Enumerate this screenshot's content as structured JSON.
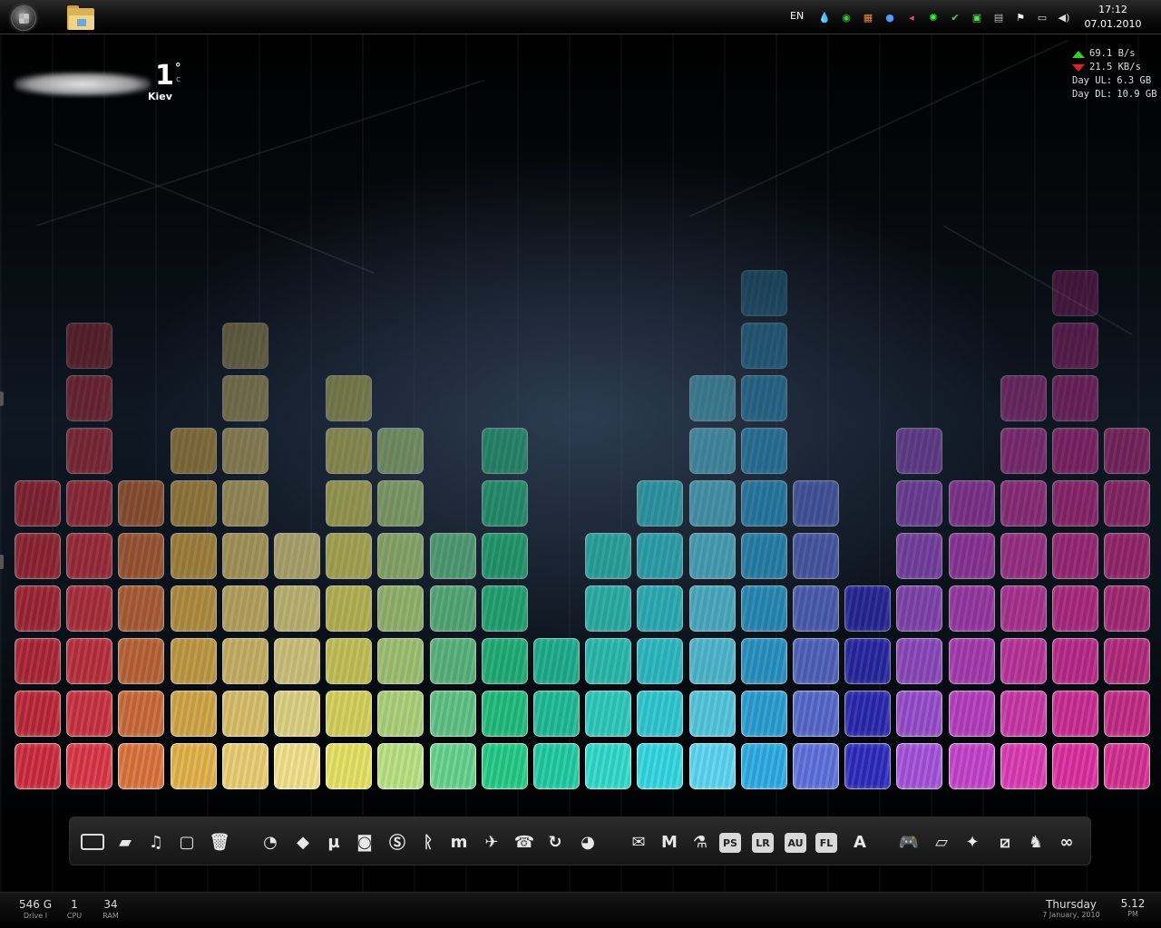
{
  "taskbar": {
    "start_icon": "windows-orb-icon",
    "pinned": [
      {
        "name": "windows-explorer",
        "icon": "folder-icon"
      }
    ],
    "language": "EN",
    "tray_icons": [
      {
        "name": "water-drop",
        "glyph": "💧"
      },
      {
        "name": "green-circle",
        "glyph": "◉"
      },
      {
        "name": "colorful-app",
        "glyph": "▦"
      },
      {
        "name": "blue-ball",
        "glyph": "●"
      },
      {
        "name": "red-arrow",
        "glyph": "◂"
      },
      {
        "name": "razer",
        "glyph": "✺"
      },
      {
        "name": "green-shield",
        "glyph": "✔"
      },
      {
        "name": "green-lock",
        "glyph": "▣"
      },
      {
        "name": "gray-device",
        "glyph": "▤"
      },
      {
        "name": "flag",
        "glyph": "⚑"
      },
      {
        "name": "network",
        "glyph": "▭"
      },
      {
        "name": "volume",
        "glyph": "◀)"
      }
    ],
    "clock": {
      "time": "17:12",
      "date": "07.01.2010"
    }
  },
  "weather": {
    "temp": "1",
    "deg": "°",
    "unit": "c",
    "city": "Kiev"
  },
  "network": {
    "upload_rate": "69.1 B/s",
    "download_rate": "21.5 KB/s",
    "day_ul_label": "Day UL:",
    "day_ul": "6.3 GB",
    "day_dl_label": "Day DL:",
    "day_dl": "10.9 GB"
  },
  "equalizer": {
    "columns": [
      {
        "color": "#c8283a",
        "level": 6
      },
      {
        "color": "#d83344",
        "level": 9
      },
      {
        "color": "#d8703a",
        "level": 6
      },
      {
        "color": "#e0b048",
        "level": 7
      },
      {
        "color": "#e8cc70",
        "level": 9
      },
      {
        "color": "#efe08a",
        "level": 5
      },
      {
        "color": "#e4e060",
        "level": 8
      },
      {
        "color": "#b8e080",
        "level": 7
      },
      {
        "color": "#64d08c",
        "level": 5
      },
      {
        "color": "#22c884",
        "level": 7
      },
      {
        "color": "#1ec8a0",
        "level": 3
      },
      {
        "color": "#2ed8c8",
        "level": 5
      },
      {
        "color": "#30d6e0",
        "level": 6
      },
      {
        "color": "#58d4ee",
        "level": 8
      },
      {
        "color": "#2aa8e0",
        "level": 10
      },
      {
        "color": "#5a6ed8",
        "level": 6
      },
      {
        "color": "#2a28b8",
        "level": 4
      },
      {
        "color": "#a050d8",
        "level": 7
      },
      {
        "color": "#c040c8",
        "level": 6
      },
      {
        "color": "#d838b0",
        "level": 8
      },
      {
        "color": "#d82c9c",
        "level": 10
      },
      {
        "color": "#d02c8c",
        "level": 7
      }
    ]
  },
  "dock": {
    "icons": [
      {
        "name": "computer",
        "glyph": "▭",
        "kind": "box"
      },
      {
        "name": "documents",
        "glyph": "▰"
      },
      {
        "name": "music",
        "glyph": "♫"
      },
      {
        "name": "pictures",
        "glyph": "▢"
      },
      {
        "name": "recycle-bin",
        "glyph": "🗑"
      },
      {
        "name": "firefox",
        "glyph": "◔"
      },
      {
        "name": "app-fox",
        "glyph": "◆"
      },
      {
        "name": "utorrent",
        "glyph": "µ"
      },
      {
        "name": "messenger",
        "glyph": "◙"
      },
      {
        "name": "skype",
        "glyph": "Ⓢ"
      },
      {
        "name": "steam-like",
        "glyph": "ᚱ"
      },
      {
        "name": "mirc",
        "glyph": "m"
      },
      {
        "name": "tool-a",
        "glyph": "✈"
      },
      {
        "name": "tool-b",
        "glyph": "☎"
      },
      {
        "name": "refresh-app",
        "glyph": "↻"
      },
      {
        "name": "globe-app",
        "glyph": "◕"
      },
      {
        "name": "envelope-app",
        "glyph": "✉"
      },
      {
        "name": "media-studio",
        "glyph": "M"
      },
      {
        "name": "flask-app",
        "glyph": "⚗"
      },
      {
        "name": "photoshop",
        "glyph": "PS",
        "kind": "txt"
      },
      {
        "name": "lightroom",
        "glyph": "LR",
        "kind": "txt"
      },
      {
        "name": "audition",
        "glyph": "AU",
        "kind": "txt"
      },
      {
        "name": "flash",
        "glyph": "FL",
        "kind": "txt"
      },
      {
        "name": "font-app",
        "glyph": "A"
      },
      {
        "name": "gamepad",
        "glyph": "🎮"
      },
      {
        "name": "game-car",
        "glyph": "▱"
      },
      {
        "name": "game-b",
        "glyph": "✦"
      },
      {
        "name": "need-for-speed",
        "glyph": "⧄"
      },
      {
        "name": "counter-strike",
        "glyph": "♞"
      },
      {
        "name": "network-app",
        "glyph": "∞"
      }
    ]
  },
  "bottom_bar": {
    "stats": [
      {
        "value": "546 G",
        "label": "Drive I"
      },
      {
        "value": "1",
        "label": "CPU"
      },
      {
        "value": "34",
        "label": "RAM"
      }
    ],
    "day": "Thursday",
    "full_date": "7 January, 2010",
    "time": "5.12",
    "ampm": "PM"
  }
}
